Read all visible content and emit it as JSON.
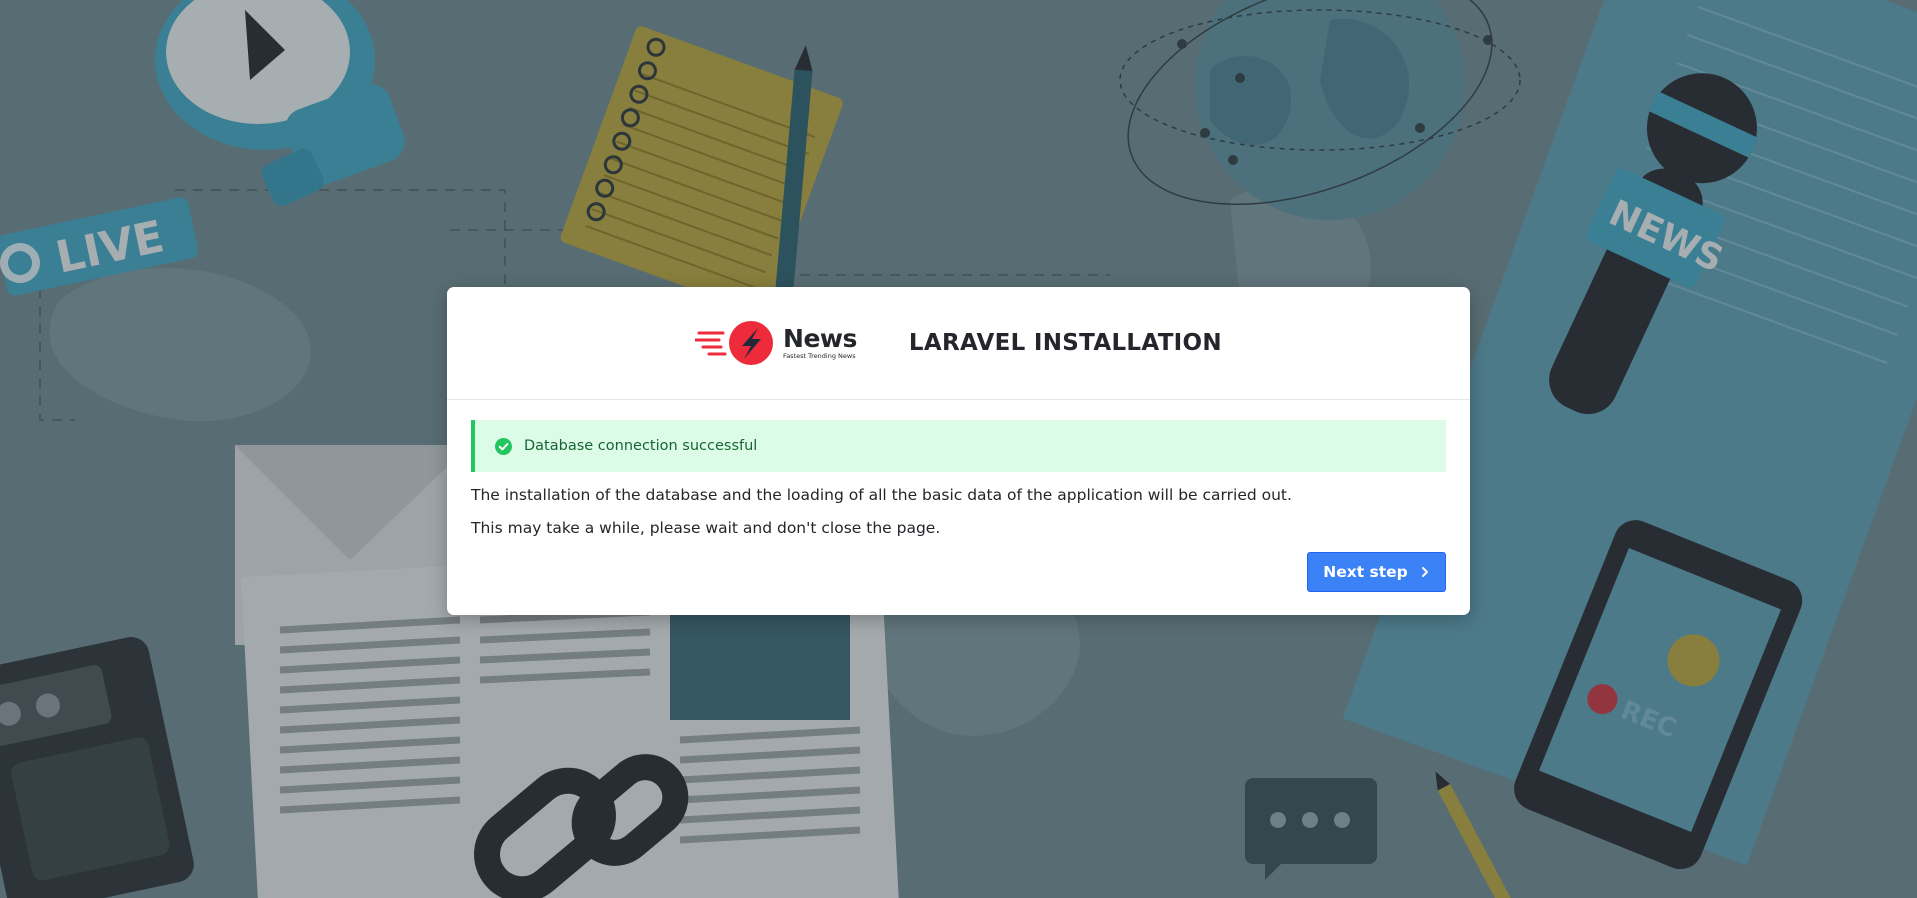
{
  "background": {
    "sticker_live": "LIVE",
    "sticker_news": "NEWS",
    "sticker_rec": "REC"
  },
  "brand": {
    "name": "News",
    "tagline": "Fastest Trending News",
    "accent_color": "#ee2b3b"
  },
  "header": {
    "title": "LARAVEL INSTALLATION"
  },
  "alert": {
    "icon": "check-circle-icon",
    "message": "Database connection successful",
    "color": "#22c55e"
  },
  "body": {
    "paragraph_1": "The installation of the database and the loading of all the basic data of the application will be carried out.",
    "paragraph_2": "This may take a while, please wait and don't close the page."
  },
  "actions": {
    "next_label": "Next step",
    "next_icon": "chevron-right-icon",
    "button_color": "#3b82f6"
  }
}
